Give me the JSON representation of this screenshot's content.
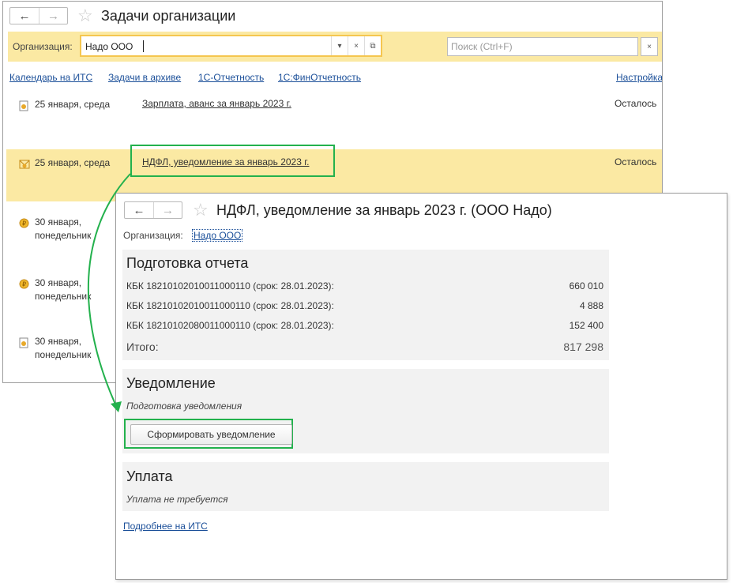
{
  "back_window": {
    "title": "Задачи организации",
    "nav_back": "←",
    "nav_forward": "→",
    "org_label": "Организация:",
    "org_value": "Надо ООО",
    "search_placeholder": "Поиск (Ctrl+F)",
    "clear_glyph": "×",
    "dropdown_glyph": "▾",
    "open_glyph": "⧉",
    "links": [
      "Календарь на ИТС",
      "Задачи в архиве",
      "1С-Отчетность",
      "1С:ФинОтчетность"
    ],
    "settings_link": "Настройка",
    "tasks": [
      {
        "date": "25 января, среда",
        "title": "Зарплата, аванс за январь 2023 г.",
        "status": "Осталось"
      },
      {
        "date": "25 января, среда",
        "title": "НДФЛ, уведомление за январь 2023 г.",
        "status": "Осталось"
      },
      {
        "date": "30 января, понедельник",
        "title": "",
        "status": ""
      },
      {
        "date": "30 января, понедельник",
        "title": "",
        "status": ""
      },
      {
        "date": "30 января, понедельник",
        "title": "",
        "status": ""
      }
    ]
  },
  "front_window": {
    "title": "НДФЛ, уведомление за январь 2023 г. (ООО Надо)",
    "nav_back": "←",
    "nav_forward": "→",
    "org_label": "Организация:",
    "org_value": "Надо ООО",
    "report_section": {
      "heading": "Подготовка отчета",
      "rows": [
        {
          "label": "КБК 18210102010011000110 (срок: 28.01.2023):",
          "amount": "660 010"
        },
        {
          "label": "КБК 18210102010011000110 (срок: 28.01.2023):",
          "amount": "4 888"
        },
        {
          "label": "КБК 18210102080011000110 (срок: 28.01.2023):",
          "amount": "152 400"
        }
      ],
      "total_label": "Итого:",
      "total_amount": "817 298"
    },
    "notice_section": {
      "heading": "Уведомление",
      "status": "Подготовка уведомления",
      "button_label": "Сформировать уведомление"
    },
    "payment_section": {
      "heading": "Уплата",
      "status": "Уплата не требуется"
    },
    "more_link": "Подробнее на ИТС"
  },
  "colors": {
    "highlight_bg": "#fbe9a3",
    "org_field_border": "#f5c64f",
    "link": "#1b4f99",
    "annotation_green": "#23b14d",
    "section_bg": "#f2f2f2"
  }
}
